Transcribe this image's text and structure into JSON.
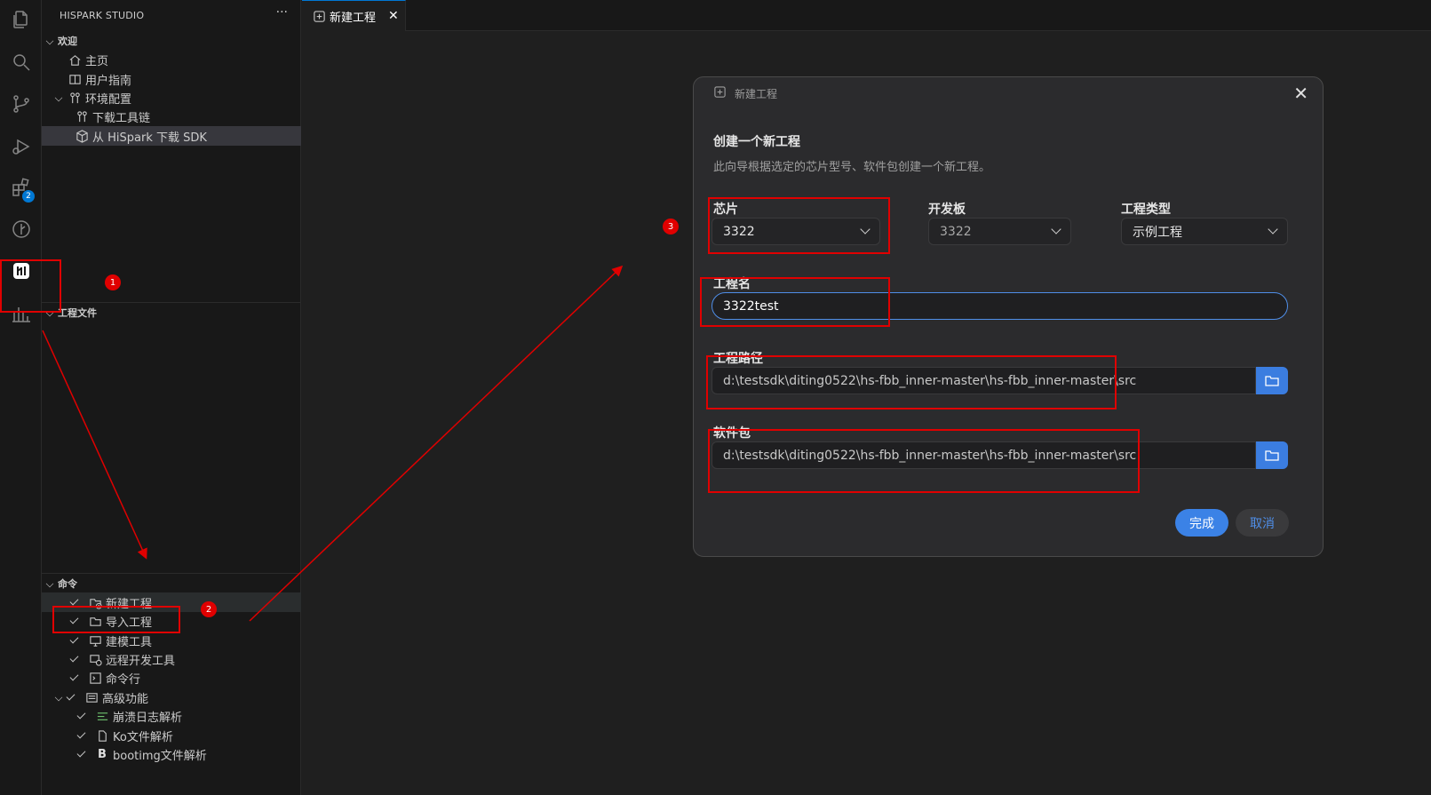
{
  "sidebar": {
    "title": "HISPARK STUDIO",
    "more": "···",
    "welcome": {
      "header": "欢迎",
      "items": [
        {
          "label": "主页",
          "icon": "home-icon"
        },
        {
          "label": "用户指南",
          "icon": "book-icon"
        },
        {
          "label": "环境配置",
          "icon": "settings-group-icon"
        },
        {
          "label": "下载工具链",
          "icon": "toolchain-icon"
        },
        {
          "label": "从 HiSpark 下载 SDK",
          "icon": "package-icon"
        }
      ]
    },
    "project_files": {
      "header": "工程文件"
    },
    "commands": {
      "header": "命令",
      "items": [
        {
          "label": "新建工程",
          "icon": "new-project-icon"
        },
        {
          "label": "导入工程",
          "icon": "folder-open-icon"
        },
        {
          "label": "建模工具",
          "icon": "monitor-icon"
        },
        {
          "label": "远程开发工具",
          "icon": "remote-icon"
        },
        {
          "label": "命令行",
          "icon": "terminal-icon"
        },
        {
          "label": "高级功能",
          "icon": "advanced-icon"
        }
      ],
      "advanced_items": [
        {
          "label": "崩溃日志解析",
          "icon": "log-icon"
        },
        {
          "label": "Ko文件解析",
          "icon": "file-icon"
        },
        {
          "label": "bootimg文件解析",
          "icon": "bold-b-icon"
        }
      ]
    }
  },
  "activity_bar": {
    "extensions_badge": "2"
  },
  "tab": {
    "label": "新建工程",
    "close": "✕"
  },
  "dialog": {
    "title": "新建工程",
    "close": "✕",
    "heading": "创建一个新工程",
    "subtitle": "此向导根据选定的芯片型号、软件包创建一个新工程。",
    "chip": {
      "label": "芯片",
      "value": "3322"
    },
    "board": {
      "label": "开发板",
      "value": "3322"
    },
    "project_type": {
      "label": "工程类型",
      "value": "示例工程"
    },
    "project_name": {
      "label": "工程名",
      "value": "3322test"
    },
    "project_path": {
      "label": "工程路径",
      "value": "d:\\testsdk\\diting0522\\hs-fbb_inner-master\\hs-fbb_inner-master\\src"
    },
    "package": {
      "label": "软件包",
      "value": "d:\\testsdk\\diting0522\\hs-fbb_inner-master\\hs-fbb_inner-master\\src"
    },
    "finish_button": "完成",
    "cancel_button": "取消"
  },
  "annotations": {
    "marker1": "1",
    "marker2": "2",
    "marker3": "3",
    "color": "#e00000"
  },
  "colors": {
    "accent": "#3b82e6",
    "background": "#1f1f1f",
    "sidebar": "#181818"
  }
}
